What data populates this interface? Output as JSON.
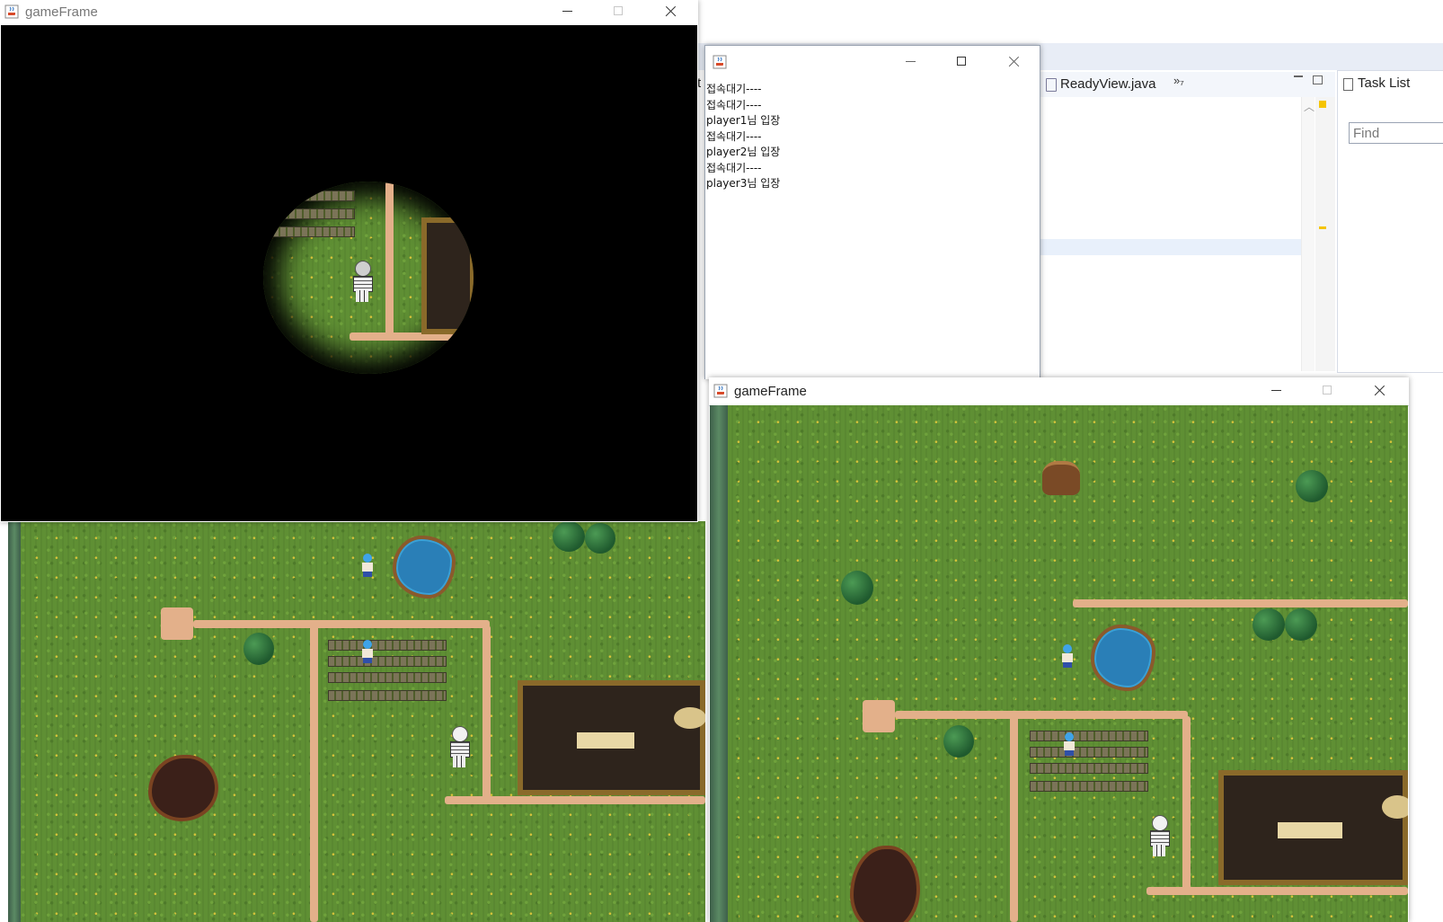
{
  "eclipse": {
    "editor_tab": "ReadyView.java",
    "overflow_chevron": "»₇",
    "task_list_title": "Task List",
    "find_placeholder": "Find",
    "edge_text": "t"
  },
  "windows": {
    "game1": {
      "title": "gameFrame"
    },
    "console": {
      "title": "",
      "lines": [
        "접속대기----",
        "접속대기----",
        "player1님 입장",
        "접속대기----",
        "player2님 입장",
        "접속대기----",
        "player3님 입장"
      ]
    },
    "game2": {
      "title": "gameFrame"
    }
  },
  "icons": {
    "java": "java-coffee-cup-icon",
    "minimize": "minimize-icon",
    "maximize": "maximize-icon",
    "close": "close-icon",
    "player": "blue-player-sprite",
    "enemy": "skeleton-sprite"
  },
  "colors": {
    "grass": "#5f8f34",
    "path": "#e3b08a",
    "water": "#2a7fb7",
    "darkness": "#000000"
  }
}
